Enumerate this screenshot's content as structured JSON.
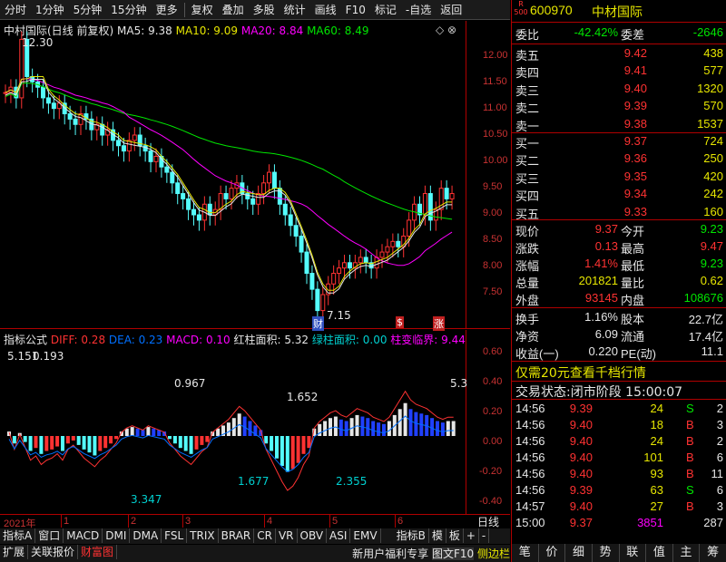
{
  "toolbar": [
    "分时",
    "1分钟",
    "5分钟",
    "15分钟",
    "更多",
    "复权",
    "叠加",
    "多股",
    "统计",
    "画线",
    "F10",
    "标记",
    "-自选",
    "返回"
  ],
  "kline": {
    "title": "中村国际(日线 前复权)",
    "ma": [
      {
        "l": "MA5: 9.38",
        "c": "#e6e6e6"
      },
      {
        "l": "MA10: 9.09",
        "c": "#e6e600"
      },
      {
        "l": "MA20: 8.84",
        "c": "#ff00ff"
      },
      {
        "l": "MA60: 8.49",
        "c": "#00e600"
      }
    ],
    "high": "12.30",
    "low": "7.15",
    "yticks": [
      "12.00",
      "11.50",
      "11.00",
      "10.50",
      "10.00",
      "9.50",
      "9.00",
      "8.50",
      "8.00",
      "7.50"
    ],
    "marks": [
      "财",
      "$",
      "涨"
    ]
  },
  "macd": {
    "title": "指标公式",
    "items": [
      {
        "l": "DIFF: 0.28",
        "c": "#ff3232"
      },
      {
        "l": "DEA: 0.23",
        "c": "#0070ff"
      },
      {
        "l": "MACD: 0.10",
        "c": "#ff00ff"
      },
      {
        "l": "红柱面积: 5.32",
        "c": "#e6e6e6"
      },
      {
        "l": "绿柱面积: 0.00",
        "c": "#00d0d0"
      },
      {
        "l": "柱变临界: 9.44",
        "c": "#ff00ff"
      }
    ],
    "yticks": [
      "0.60",
      "0.40",
      "0.20",
      "0.00",
      "-0.20",
      "-0.40"
    ],
    "labels": [
      "5.151",
      "0.193",
      "0.967",
      "1.652",
      "5.3",
      "1.677",
      "2.355",
      "3.347"
    ]
  },
  "xaxis": [
    "2021年",
    "1",
    "2",
    "3",
    "4",
    "5",
    "6"
  ],
  "xaxis_right": "日线",
  "tabs1": [
    "指标A",
    "窗口",
    "MACD",
    "DMI",
    "DMA",
    "FSL",
    "TRIX",
    "BRAR",
    "CR",
    "VR",
    "OBV",
    "ASI",
    "EMV",
    "指标B",
    "模",
    "板",
    "+",
    "-"
  ],
  "tabs2": [
    "扩展",
    "关联报价",
    "财富图"
  ],
  "tabs2_right": "新用户福利专享",
  "tabs2_right2": "图文F10",
  "tabs2_right3": "侧边栏",
  "stock": {
    "code": "600970",
    "name": "中材国际",
    "tag": "R",
    "tag2": "500"
  },
  "weibi": {
    "l1": "委比",
    "v1": "-42.42%",
    "l2": "委差",
    "v2": "-2646"
  },
  "asks": [
    {
      "l": "卖五",
      "p": "9.42",
      "v": "438"
    },
    {
      "l": "卖四",
      "p": "9.41",
      "v": "577"
    },
    {
      "l": "卖三",
      "p": "9.40",
      "v": "1320"
    },
    {
      "l": "卖二",
      "p": "9.39",
      "v": "570"
    },
    {
      "l": "卖一",
      "p": "9.38",
      "v": "1537"
    }
  ],
  "bids": [
    {
      "l": "买一",
      "p": "9.37",
      "v": "724"
    },
    {
      "l": "买二",
      "p": "9.36",
      "v": "250"
    },
    {
      "l": "买三",
      "p": "9.35",
      "v": "420"
    },
    {
      "l": "买四",
      "p": "9.34",
      "v": "242"
    },
    {
      "l": "买五",
      "p": "9.33",
      "v": "160"
    }
  ],
  "quote": [
    {
      "l1": "现价",
      "v1": "9.37",
      "c1": "#ff3232",
      "l2": "今开",
      "v2": "9.23",
      "c2": "#00e600"
    },
    {
      "l1": "涨跌",
      "v1": "0.13",
      "c1": "#ff3232",
      "l2": "最高",
      "v2": "9.47",
      "c2": "#ff3232"
    },
    {
      "l1": "涨幅",
      "v1": "1.41%",
      "c1": "#ff3232",
      "l2": "最低",
      "v2": "9.23",
      "c2": "#00e600"
    },
    {
      "l1": "总量",
      "v1": "201821",
      "c1": "#e6e600",
      "l2": "量比",
      "v2": "0.62",
      "c2": "#e6e600"
    },
    {
      "l1": "外盘",
      "v1": "93145",
      "c1": "#ff3232",
      "l2": "内盘",
      "v2": "108676",
      "c2": "#00e600"
    }
  ],
  "stats": [
    {
      "l1": "换手",
      "v1": "1.16%",
      "l2": "股本",
      "v2": "22.7亿"
    },
    {
      "l1": "净资",
      "v1": "6.09",
      "l2": "流通",
      "v2": "17.4亿"
    },
    {
      "l1": "收益(一)",
      "v1": "0.220",
      "l2": "PE(动)",
      "v2": "11.1"
    }
  ],
  "promo": "仅需20元查看千档行情",
  "status": {
    "l": "交易状态:",
    "v": "闭市阶段",
    "t": "15:00:07"
  },
  "ticks": [
    {
      "t": "14:56",
      "p": "9.39",
      "v": "24",
      "s": "S",
      "n": "2"
    },
    {
      "t": "14:56",
      "p": "9.40",
      "v": "18",
      "s": "B",
      "n": "3"
    },
    {
      "t": "14:56",
      "p": "9.40",
      "v": "24",
      "s": "B",
      "n": "2"
    },
    {
      "t": "14:56",
      "p": "9.40",
      "v": "101",
      "s": "B",
      "n": "6"
    },
    {
      "t": "14:56",
      "p": "9.40",
      "v": "93",
      "s": "B",
      "n": "11"
    },
    {
      "t": "14:56",
      "p": "9.39",
      "v": "63",
      "s": "S",
      "n": "6"
    },
    {
      "t": "14:57",
      "p": "9.40",
      "v": "27",
      "s": "B",
      "n": "3"
    },
    {
      "t": "15:00",
      "p": "9.37",
      "v": "3851",
      "s": "",
      "n": "287"
    }
  ],
  "bottom_tabs": [
    "笔",
    "价",
    "细",
    "势",
    "联",
    "值",
    "主",
    "筹"
  ]
}
